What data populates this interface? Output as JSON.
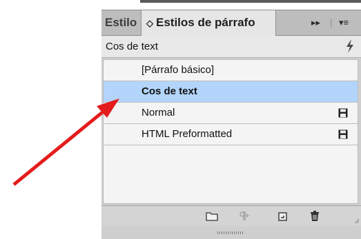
{
  "tabs": {
    "inactive_label": "Estilo",
    "active_label": "Estilos de párrafo",
    "chevron": "◇",
    "collapse_glyph": "▸▸",
    "menu_glyph": "▾≡"
  },
  "current_style": "Cos de text",
  "styles": [
    {
      "label": "[Párrafo básico]",
      "selected": false,
      "has_save_icon": false
    },
    {
      "label": "Cos de text",
      "selected": true,
      "has_save_icon": false
    },
    {
      "label": "Normal",
      "selected": false,
      "has_save_icon": true
    },
    {
      "label": "HTML Preformatted",
      "selected": false,
      "has_save_icon": true
    }
  ],
  "bottom_icons": [
    "folder-icon",
    "clear-overrides-icon",
    "new-style-icon",
    "delete-icon"
  ],
  "colors": {
    "selection": "#b3d5fb",
    "annotation_arrow": "#e41c1c"
  }
}
